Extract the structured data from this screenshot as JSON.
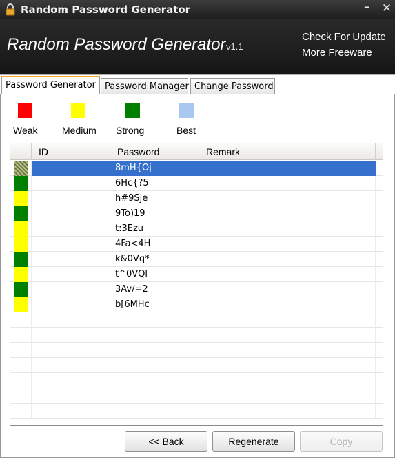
{
  "window": {
    "title": "Random Password Generator"
  },
  "banner": {
    "app_title": "Random Password Generator",
    "version": "v1.1",
    "links": [
      "Check For Update",
      "More Freeware"
    ]
  },
  "tabs": [
    {
      "label": "Password Generator",
      "active": true
    },
    {
      "label": "Password Manager",
      "active": false
    },
    {
      "label": "Change Password",
      "active": false
    }
  ],
  "legend": [
    {
      "label": "Weak",
      "color": "#ff0000"
    },
    {
      "label": "Medium",
      "color": "#ffff00"
    },
    {
      "label": "Strong",
      "color": "#008000"
    },
    {
      "label": "Best",
      "color": "#a8c8f0"
    }
  ],
  "table": {
    "columns": [
      "ID",
      "Password",
      "Remark"
    ],
    "rows": [
      {
        "strength": "Strong",
        "id": "",
        "password": "8mH{Oj",
        "remark": "",
        "selected": true
      },
      {
        "strength": "Strong",
        "id": "",
        "password": "6Hc{?5",
        "remark": ""
      },
      {
        "strength": "Medium",
        "id": "",
        "password": "h#9Sje",
        "remark": ""
      },
      {
        "strength": "Strong",
        "id": "",
        "password": "9To)19",
        "remark": ""
      },
      {
        "strength": "Medium",
        "id": "",
        "password": "t:3Ezu",
        "remark": ""
      },
      {
        "strength": "Medium",
        "id": "",
        "password": "4Fa<4H",
        "remark": ""
      },
      {
        "strength": "Strong",
        "id": "",
        "password": "k&0Vq*",
        "remark": ""
      },
      {
        "strength": "Medium",
        "id": "",
        "password": "t^0VQl",
        "remark": ""
      },
      {
        "strength": "Strong",
        "id": "",
        "password": "3Av/=2",
        "remark": ""
      },
      {
        "strength": "Medium",
        "id": "",
        "password": "b[6MHc",
        "remark": ""
      }
    ]
  },
  "buttons": {
    "back": "<< Back",
    "regenerate": "Regenerate",
    "copy": "Copy"
  },
  "icons": {
    "title_icon": "lock-icon",
    "minimize": "minimize-icon",
    "close": "close-icon"
  }
}
